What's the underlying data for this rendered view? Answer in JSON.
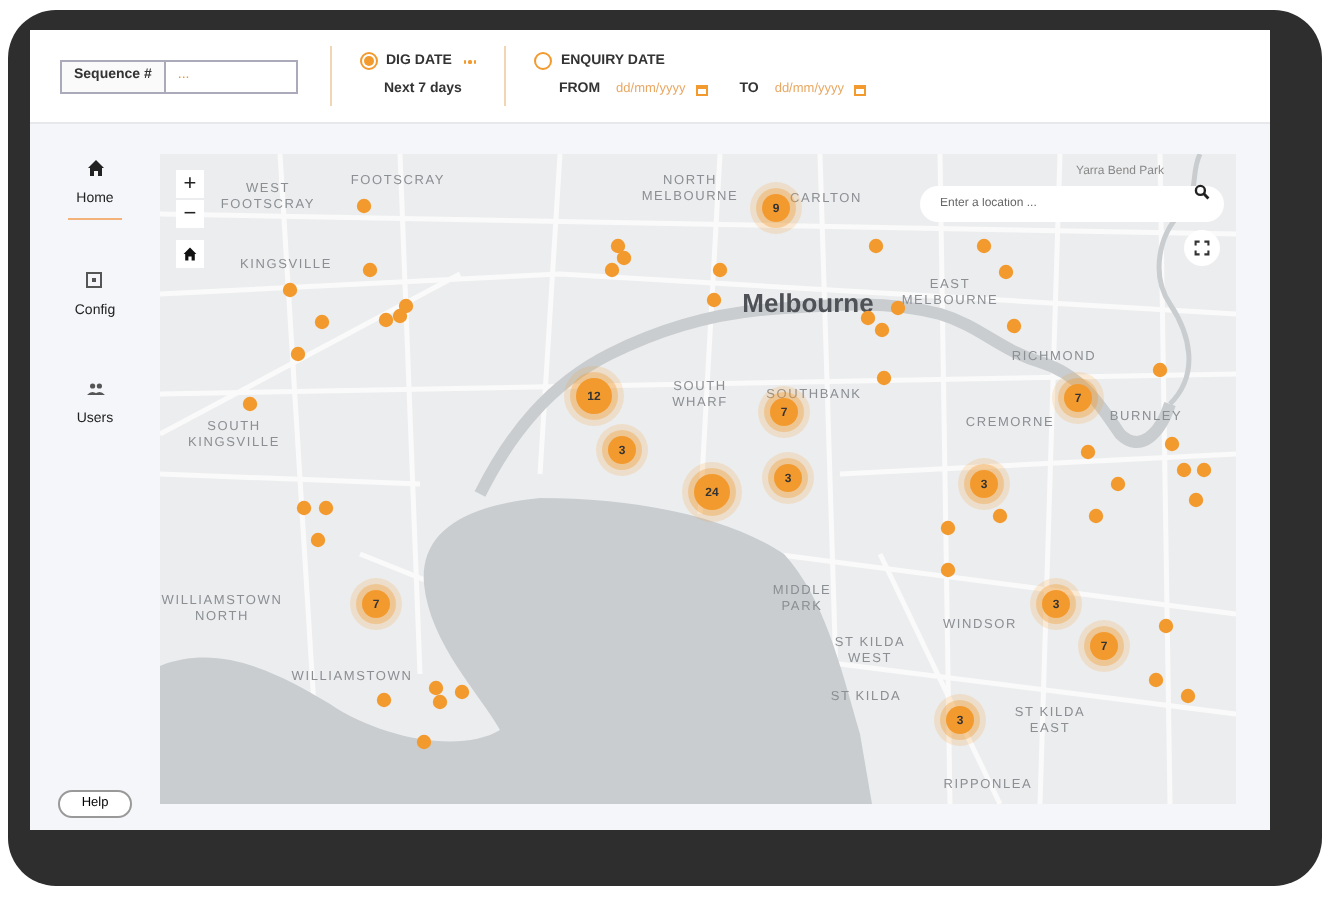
{
  "filters": {
    "sequence": {
      "label": "Sequence #",
      "placeholder": "..."
    },
    "date_options": [
      {
        "label": "DIG DATE",
        "selected": true,
        "subtitle": "Next 7 days"
      },
      {
        "label": "ENQUIRY DATE",
        "selected": false,
        "from_label": "FROM",
        "from_placeholder": "dd/mm/yyyy",
        "to_label": "TO",
        "to_placeholder": "dd/mm/yyyy"
      }
    ]
  },
  "sidebar": {
    "items": [
      {
        "label": "Home",
        "selected": true
      },
      {
        "label": "Config",
        "selected": false
      },
      {
        "label": "Users",
        "selected": false
      }
    ],
    "help_button": "Help"
  },
  "map": {
    "zoom_controls": [
      "+",
      "−"
    ],
    "search": {
      "placeholder": "Enter a location ..."
    },
    "labels": [
      {
        "kind": "suburb",
        "lines": [
          "WEST",
          "FOOTSCRAY"
        ]
      },
      {
        "kind": "suburb",
        "lines": [
          "FOOTSCRAY"
        ]
      },
      {
        "kind": "suburb",
        "lines": [
          "NORTH",
          "MELBOURNE"
        ]
      },
      {
        "kind": "suburb",
        "lines": [
          "CARLTON"
        ]
      },
      {
        "kind": "park",
        "lines": [
          "Yarra Bend Park"
        ]
      },
      {
        "kind": "suburb",
        "lines": [
          "KINGSVILLE"
        ]
      },
      {
        "kind": "city",
        "lines": [
          "Melbourne"
        ]
      },
      {
        "kind": "suburb",
        "lines": [
          "EAST",
          "MELBOURNE"
        ]
      },
      {
        "kind": "suburb",
        "lines": [
          "RICHMOND"
        ]
      },
      {
        "kind": "suburb",
        "lines": [
          "SOUTH",
          "KINGSVILLE"
        ]
      },
      {
        "kind": "suburb",
        "lines": [
          "SOUTH",
          "WHARF"
        ]
      },
      {
        "kind": "suburb",
        "lines": [
          "SOUTHBANK"
        ]
      },
      {
        "kind": "suburb",
        "lines": [
          "CREMORNE"
        ]
      },
      {
        "kind": "suburb",
        "lines": [
          "BURNLEY"
        ]
      },
      {
        "kind": "suburb",
        "lines": [
          "WILLIAMSTOWN",
          "NORTH"
        ]
      },
      {
        "kind": "suburb",
        "lines": [
          "MIDDLE",
          "PARK"
        ]
      },
      {
        "kind": "suburb",
        "lines": [
          "WINDSOR"
        ]
      },
      {
        "kind": "suburb",
        "lines": [
          "ST KILDA",
          "WEST"
        ]
      },
      {
        "kind": "suburb",
        "lines": [
          "WILLIAMSTOWN"
        ]
      },
      {
        "kind": "suburb",
        "lines": [
          "ST KILDA"
        ]
      },
      {
        "kind": "suburb",
        "lines": [
          "ST KILDA",
          "EAST"
        ]
      },
      {
        "kind": "suburb",
        "lines": [
          "RIPPONLEA"
        ]
      }
    ],
    "clusters": [
      {
        "count": "9"
      },
      {
        "count": "12"
      },
      {
        "count": "3"
      },
      {
        "count": "7"
      },
      {
        "count": "24"
      },
      {
        "count": "3"
      },
      {
        "count": "7"
      },
      {
        "count": "3"
      },
      {
        "count": "7"
      },
      {
        "count": "3"
      },
      {
        "count": "7"
      },
      {
        "count": "3"
      }
    ]
  }
}
